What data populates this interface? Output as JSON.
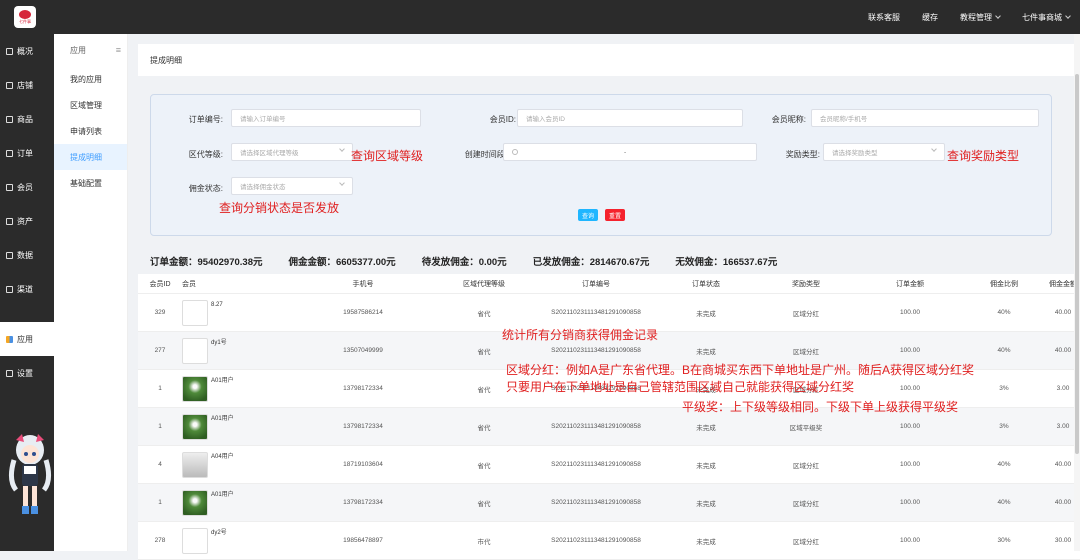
{
  "topbar": {
    "logo_text": "七件事",
    "nav": [
      {
        "label": "联系客服",
        "caret": false
      },
      {
        "label": "缓存",
        "caret": false
      },
      {
        "label": "教程管理",
        "caret": true
      },
      {
        "label": "七件事商城",
        "caret": true
      }
    ]
  },
  "sidebar": {
    "items": [
      {
        "label": "概况",
        "icon": "monitor-icon"
      },
      {
        "label": "店铺",
        "icon": "store-icon"
      },
      {
        "label": "商品",
        "icon": "goods-icon"
      },
      {
        "label": "订单",
        "icon": "order-icon"
      },
      {
        "label": "会员",
        "icon": "member-icon"
      },
      {
        "label": "资产",
        "icon": "asset-icon"
      },
      {
        "label": "数据",
        "icon": "data-icon"
      },
      {
        "label": "渠道",
        "icon": "channel-icon"
      },
      {
        "label": "应用",
        "icon": "app-icon",
        "active": true
      },
      {
        "label": "设置",
        "icon": "settings-icon"
      }
    ]
  },
  "subnav": {
    "header": "应用",
    "items": [
      {
        "label": "我的应用"
      },
      {
        "label": "区域管理"
      },
      {
        "label": "申请列表"
      },
      {
        "label": "提成明细",
        "active": true
      },
      {
        "label": "基础配置"
      }
    ]
  },
  "breadcrumb": "提成明细",
  "filters": {
    "order_no": {
      "label": "订单编号:",
      "placeholder": "请输入订单编号"
    },
    "member_id": {
      "label": "会员ID:",
      "placeholder": "请输入会员ID"
    },
    "member_nick": {
      "label": "会员昵称:",
      "placeholder": "会员昵称/手机号"
    },
    "region_level": {
      "label": "区代等级:",
      "placeholder": "请选择区域代理等级"
    },
    "created_time": {
      "label": "创建时间段:",
      "separator": "-"
    },
    "reward_type": {
      "label": "奖励类型:",
      "placeholder": "请选择奖励类型"
    },
    "commission_status": {
      "label": "佣金状态:",
      "placeholder": "请选择佣金状态"
    },
    "search_btn": "查询",
    "reset_btn": "重置"
  },
  "annotations": {
    "a1": "查询区域等级",
    "a2": "查询奖励类型",
    "a3": "查询分销状态是否发放",
    "a4": "统计所有分销商获得佣金记录",
    "a5": "区域分红：例如A是广东省代理。B在商城买东西下单地址是广州。随后A获得区域分红奖",
    "a6": "只要用户在下单地址是自己管辖范围区域自己就能获得区域分红奖",
    "a7": "平级奖：上下级等级相同。下级下单上级获得平级奖"
  },
  "summary": [
    "订单金额：95402970.38元",
    "佣金金额：6605377.00元",
    "待发放佣金：0.00元",
    "已发放佣金：2814670.67元",
    "无效佣金：166537.67元"
  ],
  "table": {
    "headers": [
      "会员ID",
      "会员",
      "手机号",
      "区域代理等级",
      "订单编号",
      "订单状态",
      "奖励类型",
      "订单金额",
      "佣金比例",
      "佣金金额"
    ],
    "rows": [
      {
        "id": "329",
        "avatar": "empty",
        "name": "8.27",
        "phone": "19587586214",
        "level": "省代",
        "order": "S20211023111348129109085​8",
        "status": "未完成",
        "reward": "区域分红",
        "amount": "100.00",
        "ratio": "40%",
        "commission": "40.00"
      },
      {
        "id": "277",
        "avatar": "empty",
        "name": "dy1号",
        "phone": "13507049999",
        "level": "省代",
        "order": "S20211023111348129109085​8",
        "status": "未完成",
        "reward": "区域分红",
        "amount": "100.00",
        "ratio": "40%",
        "commission": "40.00"
      },
      {
        "id": "1",
        "avatar": "photo",
        "name": "A01用户",
        "phone": "13798172334",
        "level": "省代",
        "order": "S20211023111348129109085​8",
        "status": "未完成",
        "reward": "区域分红",
        "amount": "100.00",
        "ratio": "3%",
        "commission": "3.00"
      },
      {
        "id": "1",
        "avatar": "photo",
        "name": "A01用户",
        "phone": "13798172334",
        "level": "省代",
        "order": "S20211023111348129109085​8",
        "status": "未完成",
        "reward": "区域平级奖",
        "amount": "100.00",
        "ratio": "3%",
        "commission": "3.00"
      },
      {
        "id": "4",
        "avatar": "char",
        "name": "A04用户",
        "phone": "18719103604",
        "level": "省代",
        "order": "S20211023111348129109085​8",
        "status": "未完成",
        "reward": "区域分红",
        "amount": "100.00",
        "ratio": "40%",
        "commission": "40.00"
      },
      {
        "id": "1",
        "avatar": "photo",
        "name": "A01用户",
        "phone": "13798172334",
        "level": "省代",
        "order": "S20211023111348129109085​8",
        "status": "未完成",
        "reward": "区域分红",
        "amount": "100.00",
        "ratio": "40%",
        "commission": "40.00"
      },
      {
        "id": "278",
        "avatar": "empty",
        "name": "dy2号",
        "phone": "19856478897",
        "level": "市代",
        "order": "S20211023111348129109085​8",
        "status": "未完成",
        "reward": "区域分红",
        "amount": "100.00",
        "ratio": "30%",
        "commission": "30.00"
      }
    ]
  },
  "colors": {
    "accent": "#409eff",
    "annotation": "#e02020",
    "search": "#1fb6ff",
    "reset": "#f5222d"
  }
}
